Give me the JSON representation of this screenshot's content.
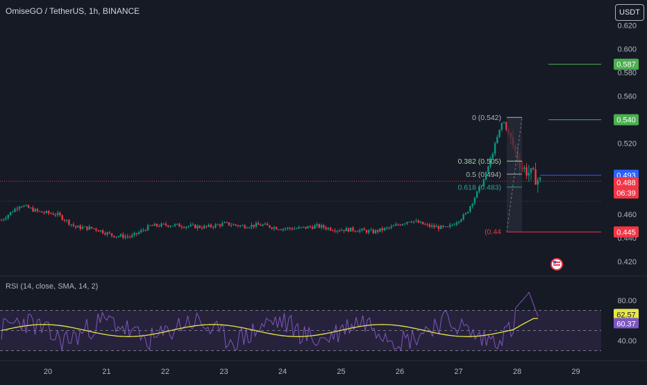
{
  "header": {
    "symbol_title": "OmiseGO / TetherUS, 1h, BINANCE",
    "currency_button": "USDT"
  },
  "rsi_panel": {
    "title": "RSI (14, close, SMA, 14, 2)",
    "value_rsi": "62.57",
    "value_sma": "60.37",
    "ticks": [
      "80.00",
      "40.00"
    ]
  },
  "price_tags": {
    "top_target": "0.587",
    "mid_target": "0.540",
    "current_line": "0.493",
    "last_price": "0.488",
    "countdown": "06:39",
    "support": "0.445"
  },
  "fib_labels": [
    {
      "text": "0 (0.542)",
      "color": "#b2b5be"
    },
    {
      "text": "0.382 (0.505)",
      "color": "#a5d6a7"
    },
    {
      "text": "0.5 (0.494)",
      "color": "#b2b5be"
    },
    {
      "text": "0.618 (0.483)",
      "color": "#26a69a"
    },
    {
      "text": "(0.44",
      "color": "#f23645"
    }
  ],
  "colors": {
    "background": "#161a25",
    "up": "#089981",
    "down": "#f23645",
    "rsi_line": "#7e57c2",
    "rsi_sma": "#e7e74a",
    "rsi_band": "#2a2440",
    "blue_tag": "#2962ff",
    "green_tag": "#4caf50"
  },
  "chart_data": {
    "type": "candlestick",
    "title": "OmiseGO / TetherUS, 1h, BINANCE",
    "x_ticks": [
      "20",
      "21",
      "22",
      "23",
      "24",
      "25",
      "26",
      "27",
      "28",
      "29"
    ],
    "y_ticks": [
      "0.620",
      "0.600",
      "0.580",
      "0.560",
      "0.520",
      "0.460",
      "0.440",
      "0.420"
    ],
    "ylim": [
      0.41,
      0.632
    ],
    "close_path": [
      0.455,
      0.468,
      0.462,
      0.46,
      0.449,
      0.448,
      0.442,
      0.441,
      0.45,
      0.451,
      0.45,
      0.449,
      0.452,
      0.45,
      0.451,
      0.448,
      0.448,
      0.45,
      0.447,
      0.447,
      0.445,
      0.449,
      0.455,
      0.45,
      0.448,
      0.46,
      0.49,
      0.54,
      0.5,
      0.488
    ],
    "fib_levels": [
      {
        "ratio": "0",
        "price": 0.542
      },
      {
        "ratio": "0.382",
        "price": 0.505
      },
      {
        "ratio": "0.5",
        "price": 0.494
      },
      {
        "ratio": "0.618",
        "price": 0.483
      }
    ],
    "horizontal_levels": [
      0.587,
      0.54,
      0.493,
      0.445
    ],
    "last_price": 0.488,
    "rsi": {
      "ylim": [
        20,
        100
      ],
      "levels": [
        70,
        50,
        30
      ],
      "last_rsi": 62.57,
      "last_sma": 60.37
    }
  }
}
